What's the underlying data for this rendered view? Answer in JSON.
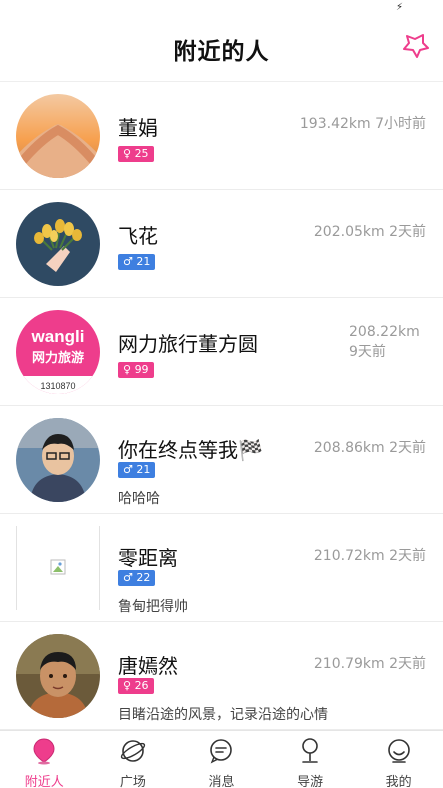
{
  "header": {
    "title": "附近的人"
  },
  "users": [
    {
      "name": "董娟",
      "gender": "♀",
      "age": "25",
      "distance": "193.42km",
      "time": "7小时前",
      "intro": ""
    },
    {
      "name": "飞花",
      "gender": "♂",
      "age": "21",
      "distance": "202.05km",
      "time": "2天前",
      "intro": ""
    },
    {
      "name": "网力旅行董方圆",
      "gender": "♀",
      "age": "99",
      "distance": "208.22km",
      "time": "9天前",
      "intro": "",
      "avatar_text": "网力旅游",
      "avatar_logo": "wangli",
      "avatar_caption": "1310870"
    },
    {
      "name": "你在终点等我🏁",
      "gender": "♂",
      "age": "21",
      "distance": "208.86km",
      "time": "2天前",
      "intro": "哈哈哈"
    },
    {
      "name": "零距离",
      "gender": "♂",
      "age": "22",
      "distance": "210.72km",
      "time": "2天前",
      "intro": "鲁甸把得帅"
    },
    {
      "name": "唐嫣然",
      "gender": "♀",
      "age": "26",
      "distance": "210.79km",
      "time": "2天前",
      "intro": "目睹沿途的风景，记录沿途的心情"
    }
  ],
  "tabs": [
    {
      "label": "附近人"
    },
    {
      "label": "广场"
    },
    {
      "label": "消息"
    },
    {
      "label": "导游"
    },
    {
      "label": "我的"
    }
  ],
  "colors": {
    "accent": "#ee3d8c",
    "male": "#3e7fe0",
    "female": "#ee3d8c"
  }
}
